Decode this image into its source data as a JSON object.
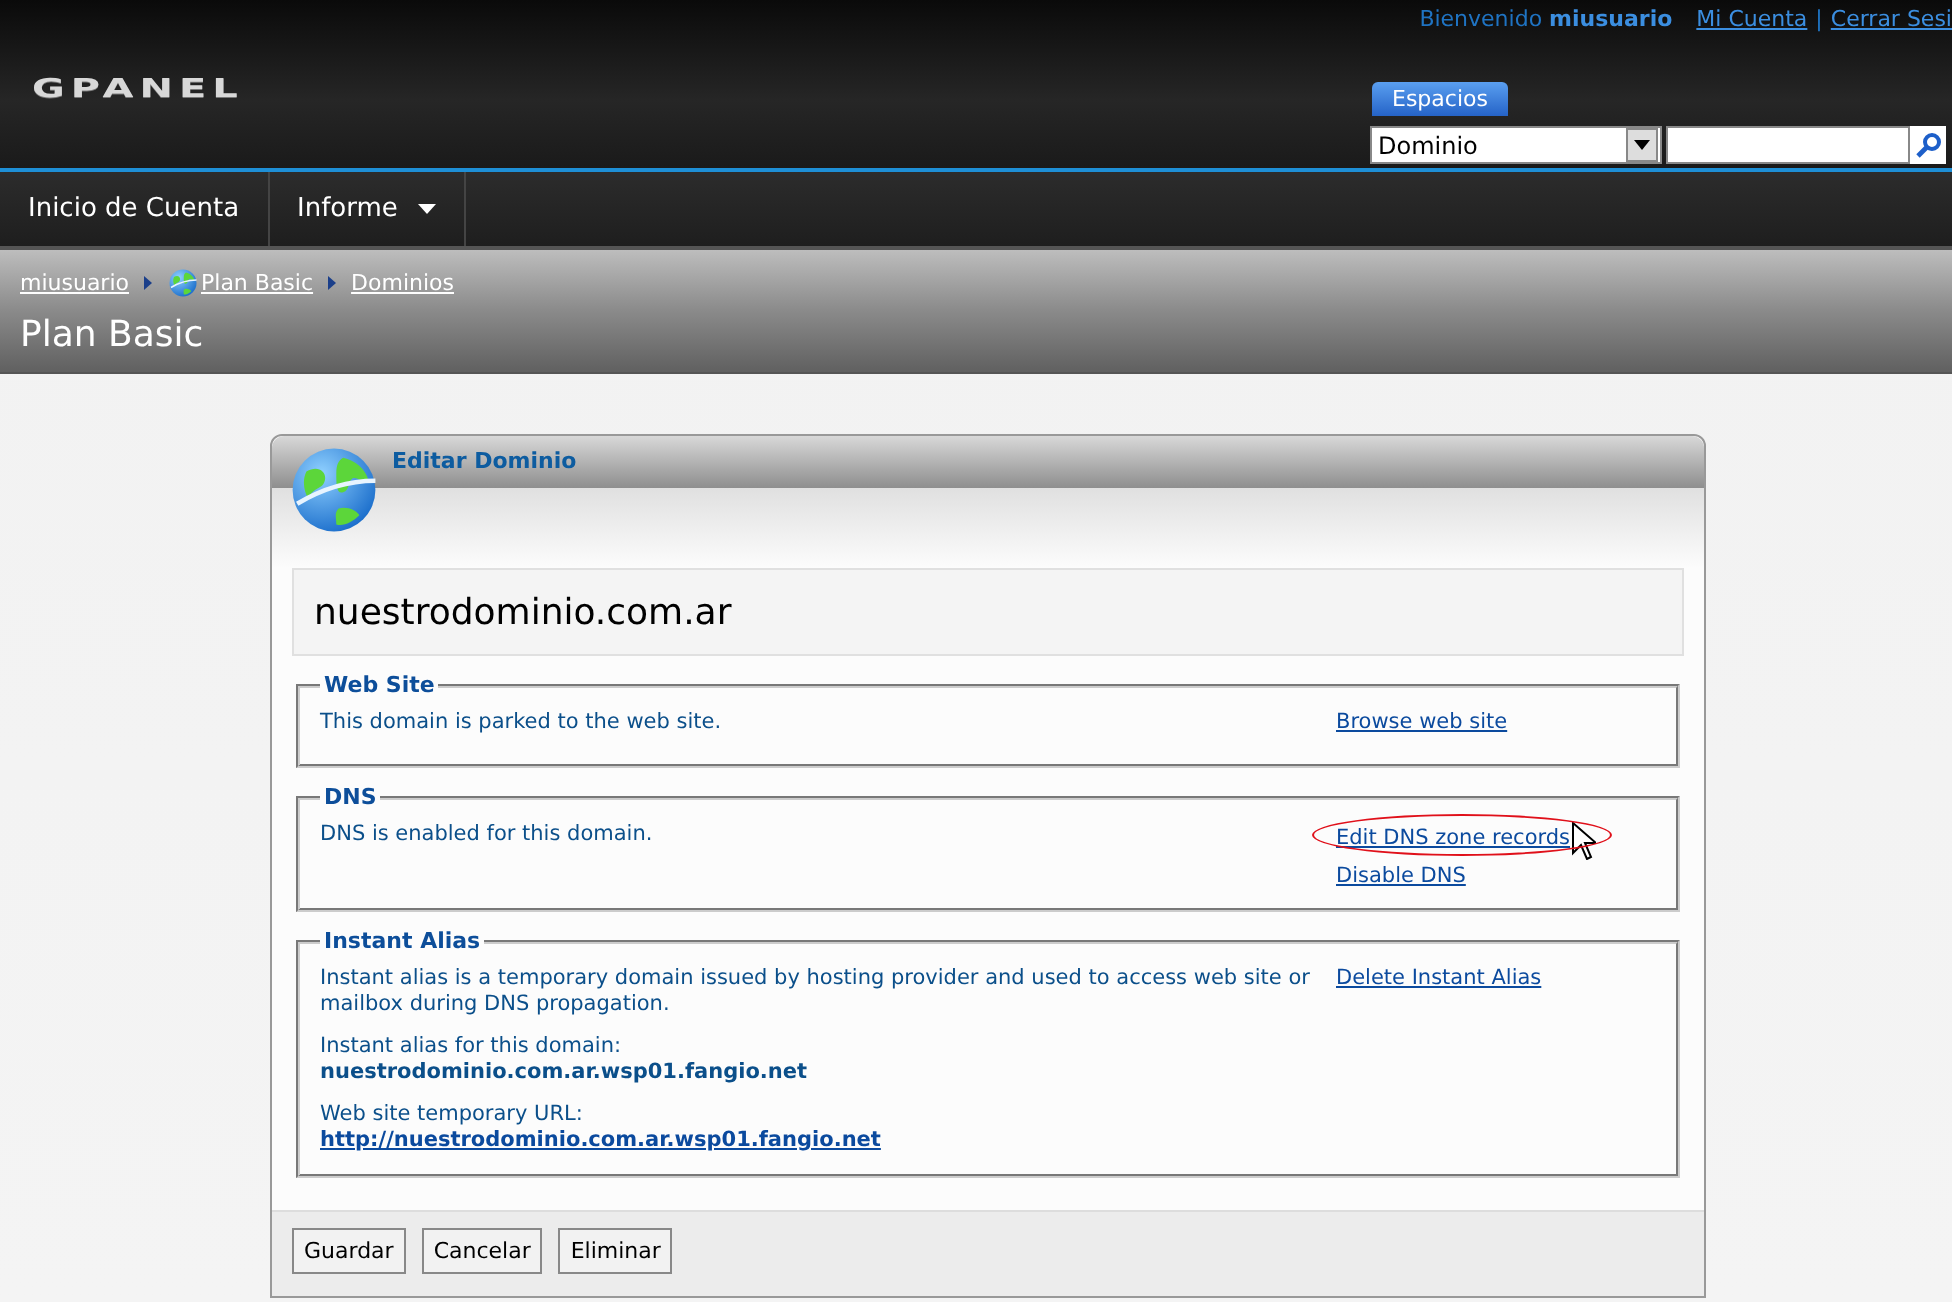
{
  "header": {
    "logo": "GPANEL",
    "welcome": "Bienvenido",
    "user": "miusuario",
    "links": [
      "Mi Cuenta",
      "Cerrar Sesi"
    ],
    "separator": "|",
    "search": {
      "tab": "Espacios",
      "scope": "Dominio"
    }
  },
  "nav": {
    "items": [
      {
        "label": "Inicio de Cuenta",
        "has_menu": false
      },
      {
        "label": "Informe",
        "has_menu": true
      }
    ]
  },
  "breadcrumb": {
    "items": [
      {
        "label": "miusuario",
        "globe": false
      },
      {
        "label": "Plan Basic",
        "globe": true
      },
      {
        "label": "Dominios",
        "globe": false
      }
    ],
    "title": "Plan Basic"
  },
  "card": {
    "title": "Editar Dominio",
    "domain": "nuestrodominio.com.ar",
    "sections": [
      {
        "legend": "Web Site",
        "content": [
          {
            "kind": "text",
            "text": "This domain is parked to the web site."
          }
        ],
        "links": [
          {
            "label": "Browse web site",
            "highlighted": false
          }
        ]
      },
      {
        "legend": "DNS",
        "content": [
          {
            "kind": "text",
            "text": "DNS is enabled for this domain."
          }
        ],
        "links": [
          {
            "label": "Edit DNS zone records",
            "highlighted": true
          },
          {
            "label": "Disable DNS",
            "highlighted": false
          }
        ]
      },
      {
        "legend": "Instant Alias",
        "content": [
          {
            "kind": "text",
            "text": "Instant alias is a temporary domain issued by hosting provider and used to access web site or mailbox during DNS propagation."
          },
          {
            "kind": "value",
            "label": "Instant alias for this domain:",
            "value": "nuestrodominio.com.ar.wsp01.fangio.net"
          },
          {
            "kind": "link",
            "label": "Web site temporary URL:",
            "value": "http://nuestrodominio.com.ar.wsp01.fangio.net"
          }
        ],
        "links": [
          {
            "label": "Delete Instant Alias",
            "highlighted": false
          }
        ]
      }
    ],
    "buttons": [
      "Guardar",
      "Cancelar",
      "Eliminar"
    ]
  }
}
